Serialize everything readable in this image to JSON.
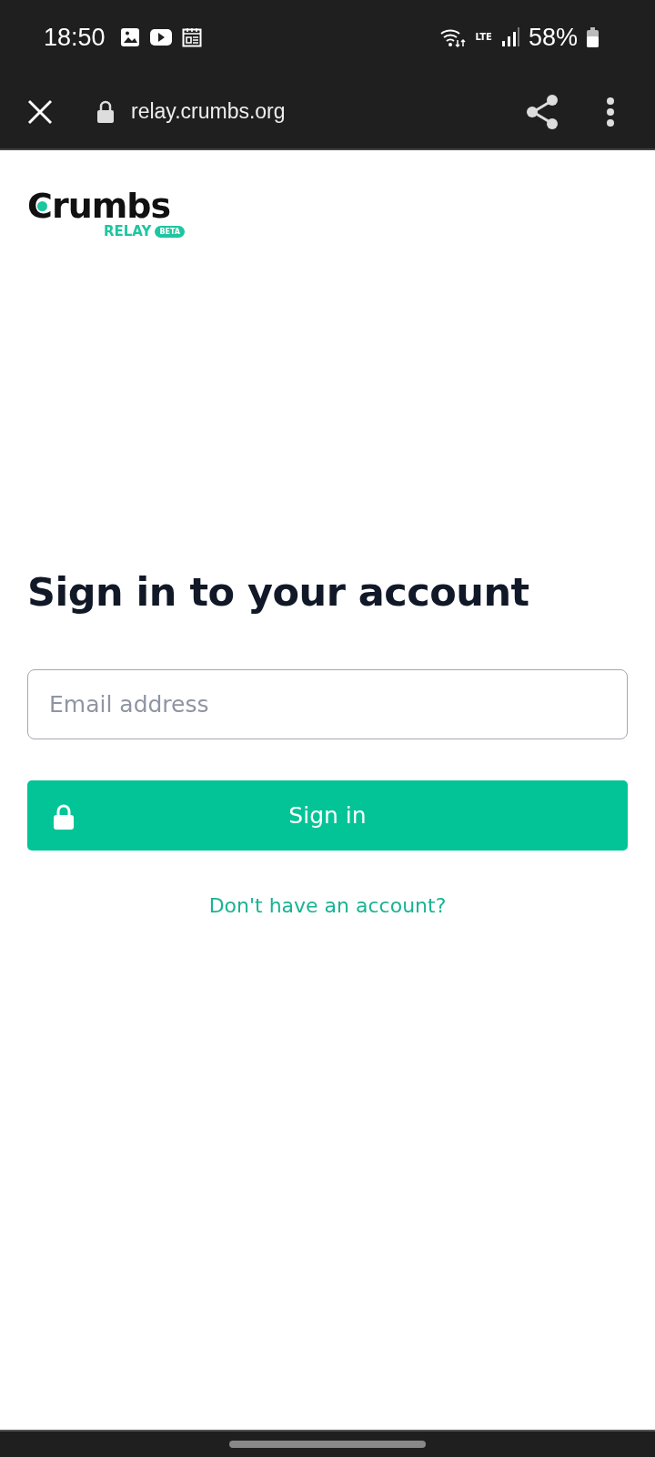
{
  "status_bar": {
    "time": "18:50",
    "network": "LTE",
    "battery": "58%"
  },
  "browser_bar": {
    "url": "relay.crumbs.org"
  },
  "logo": {
    "name": "Crumbs",
    "product": "RELAY",
    "badge": "BETA"
  },
  "heading": "Sign in to your account",
  "email_field": {
    "placeholder": "Email address"
  },
  "sign_in_button": "Sign in",
  "signup_link": "Don't have an account?"
}
